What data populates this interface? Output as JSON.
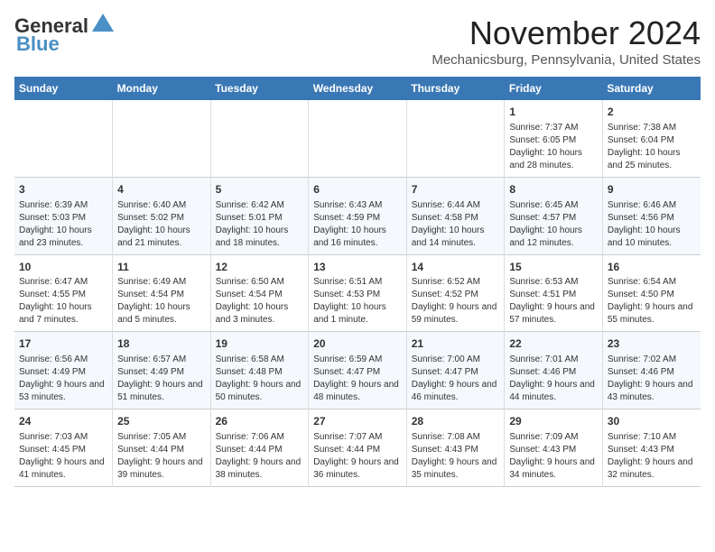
{
  "header": {
    "logo_line1": "General",
    "logo_line2": "Blue",
    "month": "November 2024",
    "location": "Mechanicsburg, Pennsylvania, United States"
  },
  "days_of_week": [
    "Sunday",
    "Monday",
    "Tuesday",
    "Wednesday",
    "Thursday",
    "Friday",
    "Saturday"
  ],
  "weeks": [
    [
      {
        "day": "",
        "info": ""
      },
      {
        "day": "",
        "info": ""
      },
      {
        "day": "",
        "info": ""
      },
      {
        "day": "",
        "info": ""
      },
      {
        "day": "",
        "info": ""
      },
      {
        "day": "1",
        "info": "Sunrise: 7:37 AM\nSunset: 6:05 PM\nDaylight: 10 hours and 28 minutes."
      },
      {
        "day": "2",
        "info": "Sunrise: 7:38 AM\nSunset: 6:04 PM\nDaylight: 10 hours and 25 minutes."
      }
    ],
    [
      {
        "day": "3",
        "info": "Sunrise: 6:39 AM\nSunset: 5:03 PM\nDaylight: 10 hours and 23 minutes."
      },
      {
        "day": "4",
        "info": "Sunrise: 6:40 AM\nSunset: 5:02 PM\nDaylight: 10 hours and 21 minutes."
      },
      {
        "day": "5",
        "info": "Sunrise: 6:42 AM\nSunset: 5:01 PM\nDaylight: 10 hours and 18 minutes."
      },
      {
        "day": "6",
        "info": "Sunrise: 6:43 AM\nSunset: 4:59 PM\nDaylight: 10 hours and 16 minutes."
      },
      {
        "day": "7",
        "info": "Sunrise: 6:44 AM\nSunset: 4:58 PM\nDaylight: 10 hours and 14 minutes."
      },
      {
        "day": "8",
        "info": "Sunrise: 6:45 AM\nSunset: 4:57 PM\nDaylight: 10 hours and 12 minutes."
      },
      {
        "day": "9",
        "info": "Sunrise: 6:46 AM\nSunset: 4:56 PM\nDaylight: 10 hours and 10 minutes."
      }
    ],
    [
      {
        "day": "10",
        "info": "Sunrise: 6:47 AM\nSunset: 4:55 PM\nDaylight: 10 hours and 7 minutes."
      },
      {
        "day": "11",
        "info": "Sunrise: 6:49 AM\nSunset: 4:54 PM\nDaylight: 10 hours and 5 minutes."
      },
      {
        "day": "12",
        "info": "Sunrise: 6:50 AM\nSunset: 4:54 PM\nDaylight: 10 hours and 3 minutes."
      },
      {
        "day": "13",
        "info": "Sunrise: 6:51 AM\nSunset: 4:53 PM\nDaylight: 10 hours and 1 minute."
      },
      {
        "day": "14",
        "info": "Sunrise: 6:52 AM\nSunset: 4:52 PM\nDaylight: 9 hours and 59 minutes."
      },
      {
        "day": "15",
        "info": "Sunrise: 6:53 AM\nSunset: 4:51 PM\nDaylight: 9 hours and 57 minutes."
      },
      {
        "day": "16",
        "info": "Sunrise: 6:54 AM\nSunset: 4:50 PM\nDaylight: 9 hours and 55 minutes."
      }
    ],
    [
      {
        "day": "17",
        "info": "Sunrise: 6:56 AM\nSunset: 4:49 PM\nDaylight: 9 hours and 53 minutes."
      },
      {
        "day": "18",
        "info": "Sunrise: 6:57 AM\nSunset: 4:49 PM\nDaylight: 9 hours and 51 minutes."
      },
      {
        "day": "19",
        "info": "Sunrise: 6:58 AM\nSunset: 4:48 PM\nDaylight: 9 hours and 50 minutes."
      },
      {
        "day": "20",
        "info": "Sunrise: 6:59 AM\nSunset: 4:47 PM\nDaylight: 9 hours and 48 minutes."
      },
      {
        "day": "21",
        "info": "Sunrise: 7:00 AM\nSunset: 4:47 PM\nDaylight: 9 hours and 46 minutes."
      },
      {
        "day": "22",
        "info": "Sunrise: 7:01 AM\nSunset: 4:46 PM\nDaylight: 9 hours and 44 minutes."
      },
      {
        "day": "23",
        "info": "Sunrise: 7:02 AM\nSunset: 4:46 PM\nDaylight: 9 hours and 43 minutes."
      }
    ],
    [
      {
        "day": "24",
        "info": "Sunrise: 7:03 AM\nSunset: 4:45 PM\nDaylight: 9 hours and 41 minutes."
      },
      {
        "day": "25",
        "info": "Sunrise: 7:05 AM\nSunset: 4:44 PM\nDaylight: 9 hours and 39 minutes."
      },
      {
        "day": "26",
        "info": "Sunrise: 7:06 AM\nSunset: 4:44 PM\nDaylight: 9 hours and 38 minutes."
      },
      {
        "day": "27",
        "info": "Sunrise: 7:07 AM\nSunset: 4:44 PM\nDaylight: 9 hours and 36 minutes."
      },
      {
        "day": "28",
        "info": "Sunrise: 7:08 AM\nSunset: 4:43 PM\nDaylight: 9 hours and 35 minutes."
      },
      {
        "day": "29",
        "info": "Sunrise: 7:09 AM\nSunset: 4:43 PM\nDaylight: 9 hours and 34 minutes."
      },
      {
        "day": "30",
        "info": "Sunrise: 7:10 AM\nSunset: 4:43 PM\nDaylight: 9 hours and 32 minutes."
      }
    ]
  ]
}
